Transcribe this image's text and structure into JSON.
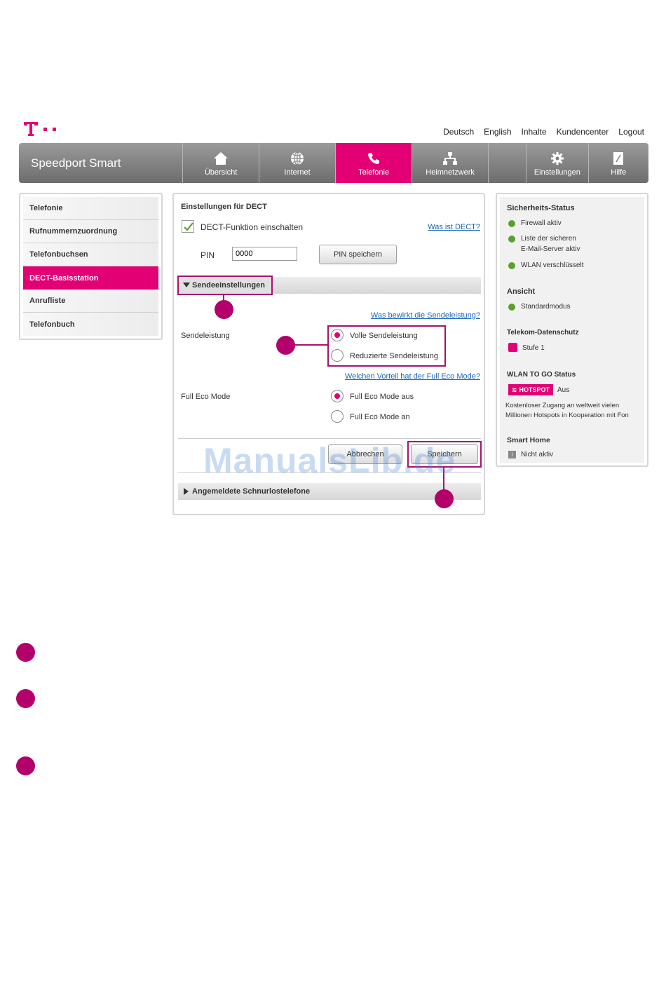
{
  "header": {
    "links": [
      "Deutsch",
      "English",
      "Inhalte",
      "Kundencenter",
      "Logout"
    ],
    "brand": "Speedport Smart",
    "nav": [
      {
        "label": "Übersicht",
        "icon": "home-icon"
      },
      {
        "label": "Internet",
        "icon": "globe-icon"
      },
      {
        "label": "Telefonie",
        "icon": "phone-icon",
        "active": true
      },
      {
        "label": "Heimnetzwerk",
        "icon": "network-icon"
      },
      {
        "label": "",
        "icon": ""
      },
      {
        "label": "Einstellungen",
        "icon": "gear-icon"
      },
      {
        "label": "Hilfe",
        "icon": "help-book-icon"
      }
    ]
  },
  "sidebar": {
    "items": [
      "Telefonie",
      "Rufnummernzuordnung",
      "Telefonbuchsen",
      "DECT-Basisstation",
      "Anrufliste",
      "Telefonbuch"
    ],
    "active_index": 3
  },
  "main": {
    "title": "Einstellungen für DECT",
    "dect_enable_label": "DECT-Funktion einschalten",
    "dect_enabled": true,
    "what_is_dect": "Was ist DECT?",
    "pin_label": "PIN",
    "pin_value": "0000",
    "pin_save": "PIN speichern",
    "send_section": "Sendeeinstellungen",
    "send_help": "Was bewirkt die Sendeleistung?",
    "send_label": "Sendeleistung",
    "send_options": [
      "Volle Sendeleistung",
      "Reduzierte Sendeleistung"
    ],
    "send_selected": 0,
    "eco_help": "Welchen Vorteil hat der Full Eco Mode?",
    "eco_label": "Full Eco Mode",
    "eco_options": [
      "Full Eco Mode aus",
      "Full Eco Mode an"
    ],
    "eco_selected": 0,
    "cancel": "Abbrechen",
    "save": "Speichern",
    "handsets_section": "Angemeldete Schnurlostelefone"
  },
  "status": {
    "security_title": "Sicherheits-Status",
    "firewall": "Firewall aktiv",
    "mail_line1": "Liste der sicheren",
    "mail_line2": "E-Mail-Server aktiv",
    "wlan": "WLAN verschlüsselt",
    "view_title": "Ansicht",
    "view_mode": "Standardmodus",
    "privacy_title": "Telekom-Datenschutz",
    "privacy_level": "Stufe 1",
    "togo_title": "WLAN TO GO Status",
    "hotspot_badge": "HOTSPOT",
    "hotspot_state": "Aus",
    "togo_desc1": "Kostenloser Zugang an weltweit vielen",
    "togo_desc2": "Millionen Hotspots in Kooperation mit Fon",
    "smarthome_title": "Smart Home",
    "smarthome_state": "Nicht aktiv"
  },
  "watermark": "ManualsLib.de",
  "colors": {
    "magenta": "#e20074",
    "callout": "#b3006b",
    "link": "#1a66b8",
    "ok": "#5aa02c"
  }
}
